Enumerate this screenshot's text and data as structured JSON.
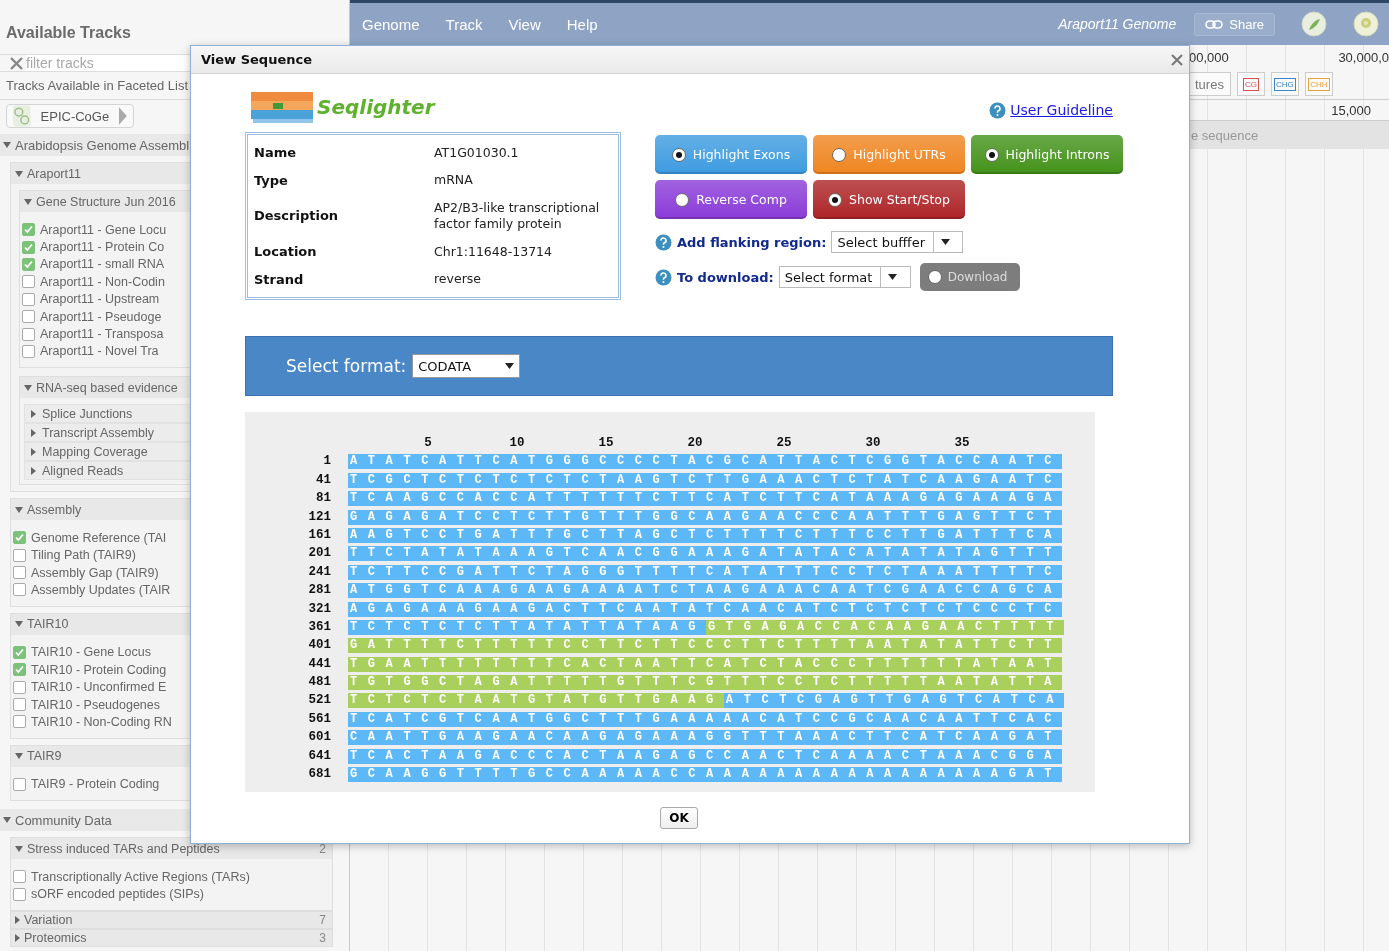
{
  "sidebar": {
    "title": "Available Tracks",
    "filter": {
      "placeholder": "filter tracks"
    },
    "faceted_link": "Tracks Available in Faceted List",
    "plugin_button": "EPIC-CoGe",
    "sections": [
      {
        "label": "Arabidopsis Genome Assembl",
        "expanded": true,
        "children": [
          {
            "label": "Araport11",
            "expanded": true,
            "children": [
              {
                "label": "Gene Structure Jun 2016",
                "expanded": true,
                "tracks": [
                  {
                    "label": "Araport11 - Gene Locu",
                    "checked": true
                  },
                  {
                    "label": "Araport11 - Protein Co",
                    "checked": true
                  },
                  {
                    "label": "Araport11 - small RNA",
                    "checked": true
                  },
                  {
                    "label": "Araport11 - Non-Codin",
                    "checked": false
                  },
                  {
                    "label": "Araport11 - Upstream",
                    "checked": false
                  },
                  {
                    "label": "Araport11 - Pseudoge",
                    "checked": false
                  },
                  {
                    "label": "Araport11 - Transposa",
                    "checked": false
                  },
                  {
                    "label": "Araport11 - Novel Tra",
                    "checked": false
                  }
                ]
              },
              {
                "label": "RNA-seq based evidence",
                "expanded": true,
                "children": [
                  {
                    "label": "Splice Junctions",
                    "expanded": false
                  },
                  {
                    "label": "Transcript Assembly",
                    "expanded": false
                  },
                  {
                    "label": "Mapping Coverage",
                    "expanded": false
                  },
                  {
                    "label": "Aligned Reads",
                    "expanded": false
                  }
                ]
              }
            ]
          },
          {
            "label": "Assembly",
            "expanded": true,
            "tracks": [
              {
                "label": "Genome Reference (TAI",
                "checked": true
              },
              {
                "label": "Tiling Path (TAIR9)",
                "checked": false
              },
              {
                "label": "Assembly Gap (TAIR9)",
                "checked": false
              },
              {
                "label": "Assembly Updates (TAIR",
                "checked": false
              }
            ]
          },
          {
            "label": "TAIR10",
            "expanded": true,
            "tracks": [
              {
                "label": "TAIR10 - Gene Locus",
                "checked": true
              },
              {
                "label": "TAIR10 - Protein Coding",
                "checked": true
              },
              {
                "label": "TAIR10 - Unconfirmed E",
                "checked": false
              },
              {
                "label": "TAIR10 - Pseudogenes",
                "checked": false
              },
              {
                "label": "TAIR10 - Non-Coding RN",
                "checked": false
              }
            ]
          },
          {
            "label": "TAIR9",
            "expanded": true,
            "tracks": [
              {
                "label": "TAIR9 - Protein Coding",
                "checked": false
              }
            ]
          }
        ]
      },
      {
        "label": "Community Data",
        "expanded": true,
        "children": [
          {
            "label": "Stress induced TARs and Peptides",
            "count": "2",
            "expanded": true,
            "tracks": [
              {
                "label": "Transcriptionally Active Regions (TARs)",
                "checked": false
              },
              {
                "label": "sORF encoded peptides (SIPs)",
                "checked": false
              }
            ]
          },
          {
            "label": "Variation",
            "count": "7",
            "expanded": false
          },
          {
            "label": "Proteomics",
            "count": "3",
            "expanded": false
          }
        ]
      }
    ]
  },
  "menu": [
    "Genome",
    "Track",
    "View",
    "Help"
  ],
  "genome_label": "Araport11 Genome",
  "share_button": "Share",
  "track_view": {
    "ruler_labels": [
      "00,000",
      "30,000,0"
    ],
    "features_button": "tures",
    "toggles": [
      {
        "label": "CG",
        "color": "#d9534f"
      },
      {
        "label": "CHG",
        "color": "#3a87c8"
      },
      {
        "label": "CHH",
        "color": "#e8a23a"
      }
    ],
    "scale_label": "15,000",
    "track_label": "e sequence"
  },
  "dialog": {
    "title": "View Sequence",
    "logo_text": "Seqlighter",
    "guideline_link": "User Guideline",
    "info": [
      {
        "label": "Name",
        "value": "AT1G01030.1"
      },
      {
        "label": "Type",
        "value": "mRNA"
      },
      {
        "label": "Description",
        "value": "AP2/B3-like transcriptional factor family protein"
      },
      {
        "label": "Location",
        "value": "Chr1:11648-13714"
      },
      {
        "label": "Strand",
        "value": "reverse"
      }
    ],
    "toggles": [
      {
        "label": "Highlight Exons",
        "color": "#3d9be0",
        "on": true
      },
      {
        "label": "Highlight UTRs",
        "color": "#ef8520",
        "on": false
      },
      {
        "label": "Highlight Introns",
        "color": "#43921a",
        "on": true
      },
      {
        "label": "Reverse Comp",
        "color": "#8a3bd8",
        "on": false
      },
      {
        "label": "Show Start/Stop",
        "color": "#ad2427",
        "on": true
      }
    ],
    "flanking": {
      "label": "Add flanking region:",
      "value": "Select bufffer"
    },
    "download": {
      "label": "To download:",
      "value": "Select format",
      "button": "Download",
      "disabled": true
    },
    "format": {
      "label": "Select format:",
      "value": "CODATA"
    },
    "sequence": {
      "ruler": [
        "5",
        "10",
        "15",
        "20",
        "25",
        "30",
        "35"
      ],
      "rows": [
        {
          "start": "1",
          "segments": [
            {
              "kind": "exon",
              "text": "ATATCATTCATGGGCCCCTACGCATTACTCGGTACCAATC"
            }
          ]
        },
        {
          "start": "41",
          "segments": [
            {
              "kind": "exon",
              "text": "TCGCTCTCTCTCTCTAAGTCTTGAAACTCTATCAAGAATC"
            }
          ]
        },
        {
          "start": "81",
          "segments": [
            {
              "kind": "exon",
              "text": "TCAAGCCACCATTTTTTCTTCATCTTCATAAAGAGAAAGA"
            }
          ]
        },
        {
          "start": "121",
          "segments": [
            {
              "kind": "exon",
              "text": "GAGAGATCCTCTTGTTTGGCAAGAACCCAATTTGAGTTCT"
            }
          ]
        },
        {
          "start": "161",
          "segments": [
            {
              "kind": "exon",
              "text": "AAGTCCTGATTTGCTTAGCTCTTTTCTTTCCTTGATTTCA"
            }
          ]
        },
        {
          "start": "201",
          "segments": [
            {
              "kind": "exon",
              "text": "TTCTATATAAAGTCAACGGAAAGATATACATATATAGTTT"
            }
          ]
        },
        {
          "start": "241",
          "segments": [
            {
              "kind": "exon",
              "text": "TCTTCCGATTCTAGGGTTTTCATATTTCCTCTAAATTTTC"
            }
          ]
        },
        {
          "start": "281",
          "segments": [
            {
              "kind": "exon",
              "text": "ATGGTCAAAGAAGAAAATCTAAGAAACAATCGAACCAGCA"
            }
          ]
        },
        {
          "start": "321",
          "segments": [
            {
              "kind": "exon",
              "text": "AGAGAAAGAAGACTTCAATATCAACATCTCTCTCTCCCTC"
            }
          ]
        },
        {
          "start": "361",
          "segments": [
            {
              "kind": "exon",
              "text": "TCTCTCTCTTATATTATAAG"
            },
            {
              "kind": "intron",
              "text": "GTGAGACCACAAGAACTTTT"
            }
          ]
        },
        {
          "start": "401",
          "segments": [
            {
              "kind": "intron",
              "text": "GATTTTCTTTTTCCTTCTTCCCTTCTTTTAATATATTCTT"
            }
          ]
        },
        {
          "start": "441",
          "segments": [
            {
              "kind": "intron",
              "text": "TGAATTTTTTTTCACTAATTCATCTACCCTTTTTTATAAT"
            }
          ]
        },
        {
          "start": "481",
          "segments": [
            {
              "kind": "intron",
              "text": "TGTGGCTAGATTTTTGTTTCGTTTCCTCTTTTTAATATTA"
            }
          ]
        },
        {
          "start": "521",
          "segments": [
            {
              "kind": "intron",
              "text": "TCTCTCTAATGTATGTTGAAG"
            },
            {
              "kind": "exon",
              "text": "ATCTCGAGTTGAGTCATCA"
            }
          ]
        },
        {
          "start": "561",
          "segments": [
            {
              "kind": "exon",
              "text": "TCATCGTCAATGGCTTTGAAAAACATCCGCAACAATTCAC"
            }
          ]
        },
        {
          "start": "601",
          "segments": [
            {
              "kind": "exon",
              "text": "CAATTGAAGAACAAGAGAAAGGTTTAAACTTCATCAAGAT"
            }
          ]
        },
        {
          "start": "641",
          "segments": [
            {
              "kind": "exon",
              "text": "TCACTAAGACCCACTAAGAGCCAACTCAAAACTAAACGGA"
            }
          ]
        },
        {
          "start": "681",
          "segments": [
            {
              "kind": "exon",
              "text": "GCAAGGTTTTGCCAAAAACCAAAAAAAAAAAAAAAAAGAT"
            }
          ]
        }
      ]
    },
    "ok_button": "OK"
  }
}
